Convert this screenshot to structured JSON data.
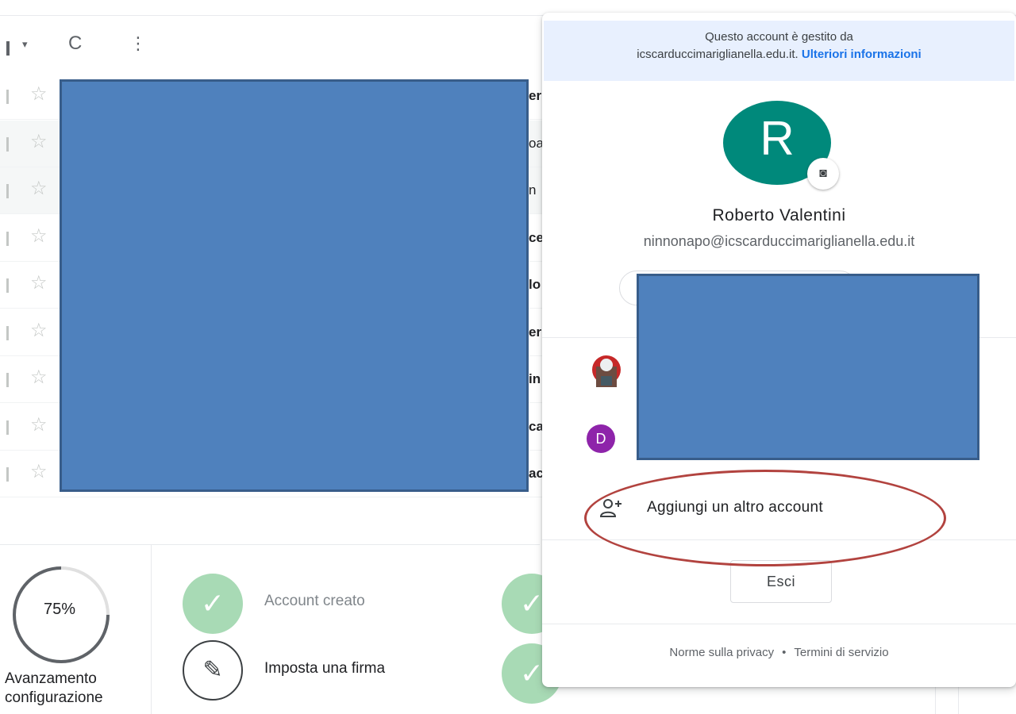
{
  "toolbar": {
    "caret_icon": "▾",
    "refresh_icon": "C",
    "more_icon": "⋮"
  },
  "mail_rows": [
    {
      "fragment": "er",
      "read": false
    },
    {
      "fragment": "oa",
      "read": true
    },
    {
      "fragment": "n",
      "read": true
    },
    {
      "fragment": "ce",
      "read": false
    },
    {
      "fragment": "lo",
      "read": false
    },
    {
      "fragment": "er",
      "read": false
    },
    {
      "fragment": "in",
      "read": false
    },
    {
      "fragment": "ca",
      "read": false
    },
    {
      "fragment": "ac",
      "read": false
    }
  ],
  "setup": {
    "progress_percent": 75,
    "progress_label": "75%",
    "progress_caption_1": "Avanzamento",
    "progress_caption_2": "configurazione",
    "tasks": [
      {
        "label": "Account creato",
        "done": true
      },
      {
        "label": "Imposta una firma",
        "done": false
      }
    ]
  },
  "account_panel": {
    "managed_line1": "Questo account è gestito da",
    "managed_domain": "icscarduccimariglianella.edu.it.",
    "managed_link": "Ulteriori informazioni",
    "avatar_letter": "R",
    "avatar_color": "#00897b",
    "camera_icon": "camera-icon",
    "name": "Roberto Valentini",
    "email": "ninnonapo@icscarduccimariglianella.edu.it",
    "other_accounts": [
      {
        "initial": "",
        "kind": "image"
      },
      {
        "initial": "D",
        "color": "#8e24aa"
      }
    ],
    "add_account_label": "Aggiungi un altro account",
    "logout_label": "Esci",
    "privacy_label": "Norme sulla privacy",
    "separator": "•",
    "terms_label": "Termini di servizio"
  },
  "colors": {
    "redaction_fill": "#4f81bd",
    "annotation_oval": "#b2433f",
    "check_green": "#a8dab5",
    "link_blue": "#1a73e8"
  }
}
